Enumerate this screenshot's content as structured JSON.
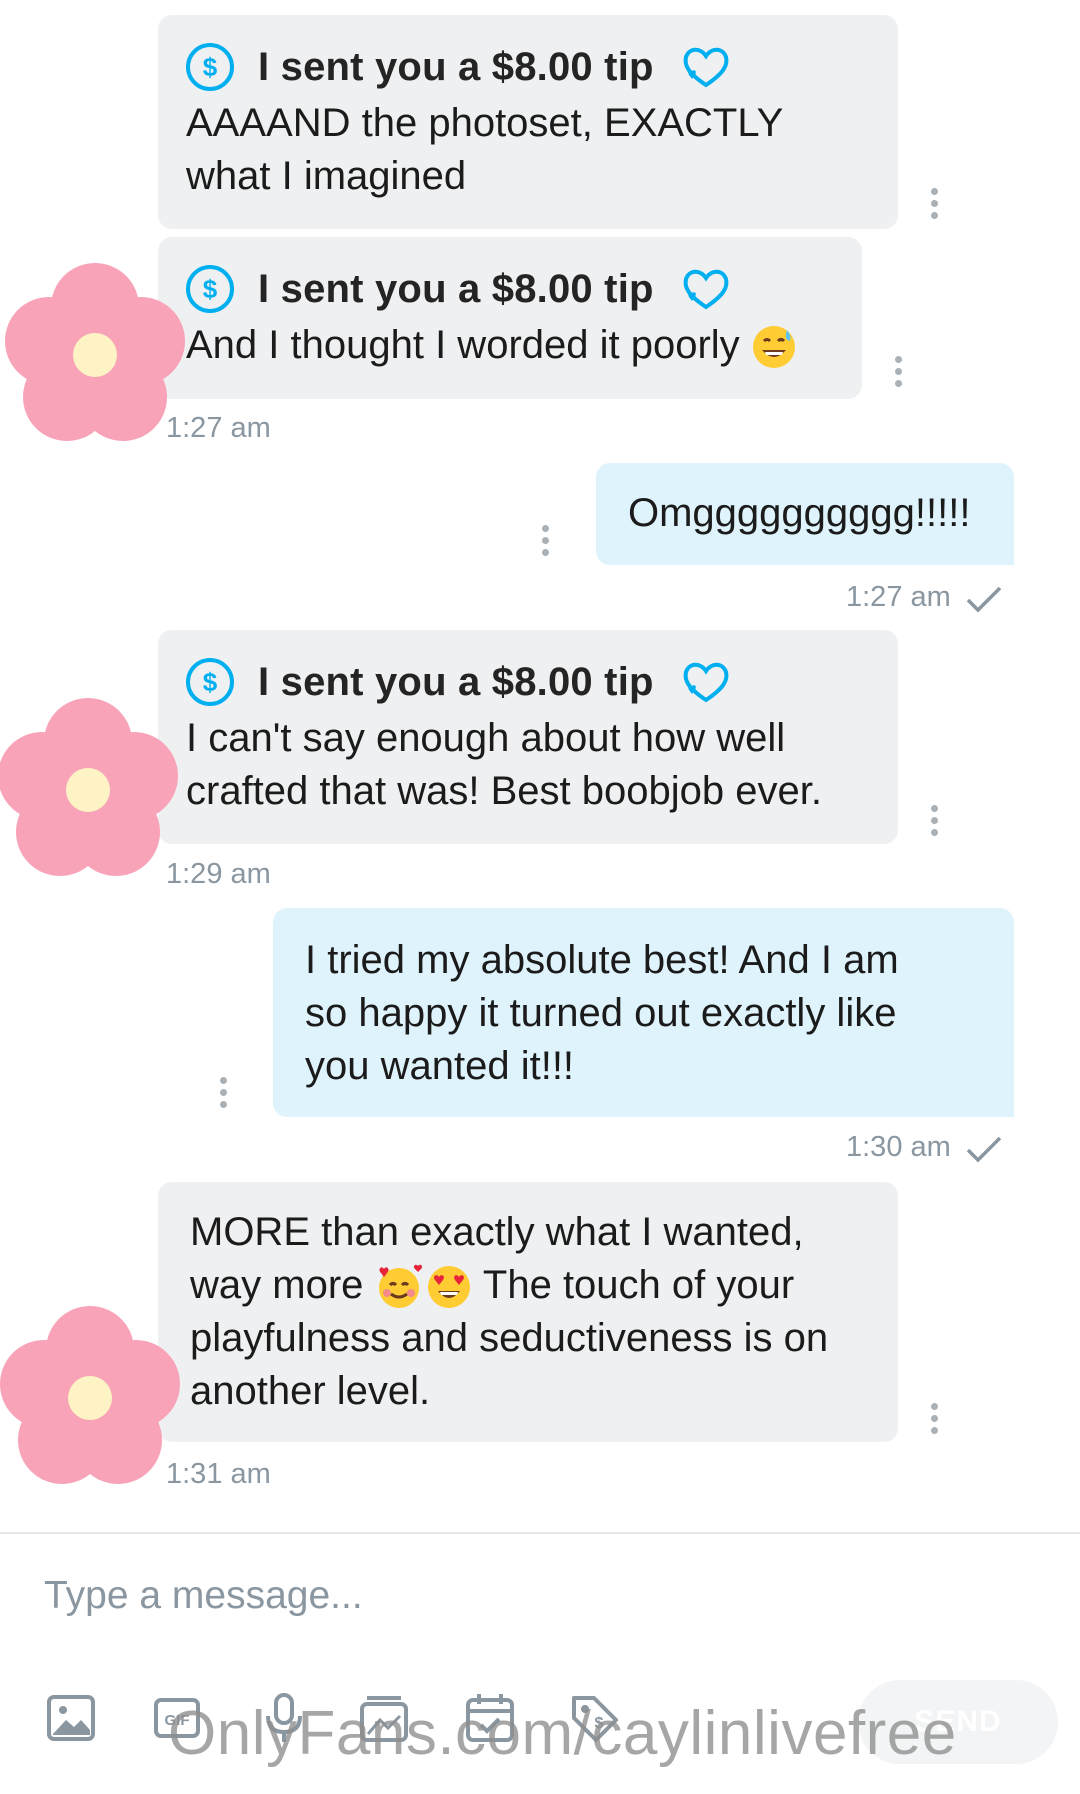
{
  "messages": [
    {
      "tip": "I sent you a $8.00 tip",
      "lines": [
        "AAAAND the photoset, EXACTLY",
        "what I imagined"
      ]
    },
    {
      "tip": "I sent you a $8.00 tip",
      "lines": [
        "And I thought I worded it poorly"
      ],
      "emoji": "grinning-sweat-emoji",
      "time": "1:27 am"
    },
    {
      "lines": [
        "Omgggggggggg!!!!!"
      ],
      "time": "1:27 am",
      "sent": true
    },
    {
      "tip": "I sent you a $8.00 tip",
      "lines": [
        "I can't say enough about how well",
        "crafted that was! Best boobjob ever."
      ],
      "time": "1:29 am"
    },
    {
      "lines": [
        "I tried my absolute best! And I am",
        "so happy it turned out exactly like",
        "you wanted it!!!"
      ],
      "time": "1:30 am",
      "sent": true
    },
    {
      "lines": [
        "MORE than exactly what I wanted,",
        "way more",
        "The touch of your",
        "playfulness and seductiveness is on",
        "another level."
      ],
      "emojis": [
        "smiling-hearts-emoji",
        "heart-eyes-emoji"
      ],
      "time": "1:31 am"
    }
  ],
  "composer": {
    "placeholder": "Type a message...",
    "send_label": "SEND",
    "tools": [
      "image-icon",
      "gif-icon",
      "microphone-icon",
      "media-vault-icon",
      "calendar-icon",
      "price-tag-icon"
    ]
  },
  "watermark": "OnlyFans.com/caylinlivefree",
  "colors": {
    "accent": "#00aff0",
    "incoming_bubble": "#eef0f1",
    "outgoing_bubble": "#dff3fc",
    "timestamp": "#8a96a0",
    "flower": "#f8a3b8"
  }
}
